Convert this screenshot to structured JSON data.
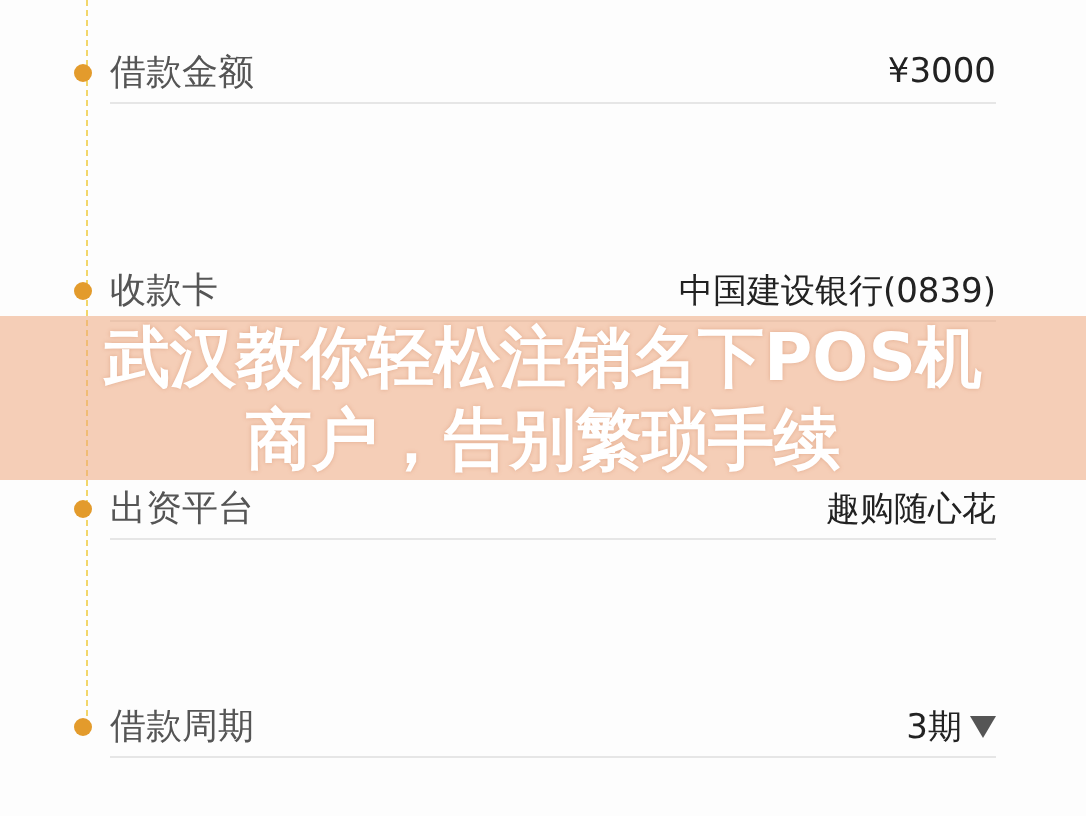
{
  "rows": [
    {
      "label": "借款金额",
      "value": "¥3000",
      "kind": "text"
    },
    {
      "label": "收款卡",
      "value": "中国建设银行(0839)",
      "kind": "text"
    },
    {
      "label": "出资平台",
      "value": "趣购随心花",
      "kind": "text"
    },
    {
      "label": "借款周期",
      "value": "3期",
      "kind": "select"
    }
  ],
  "banner": {
    "title": "武汉教你轻松注销名下POS机商户，告别繁琐手续"
  }
}
